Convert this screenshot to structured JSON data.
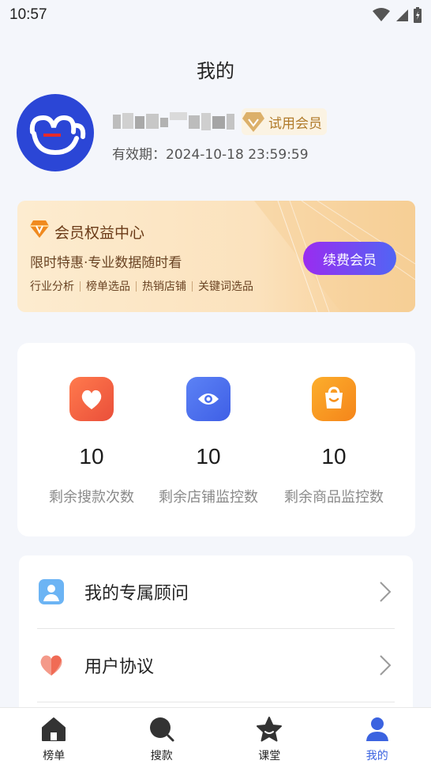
{
  "status_bar": {
    "time": "10:57"
  },
  "header": {
    "title": "我的"
  },
  "profile": {
    "member_badge": "试用会员",
    "validity": "有效期：2024-10-18 23:59:59"
  },
  "vip_card": {
    "title": "会员权益中心",
    "subtitle": "限时特惠·专业数据随时看",
    "tags": [
      "行业分析",
      "榜单选品",
      "热销店铺",
      "关键词选品"
    ],
    "renew_label": "续费会员"
  },
  "stats": [
    {
      "value": "10",
      "label": "剩余搜款次数",
      "icon": "heart-icon",
      "color": "#f0613f"
    },
    {
      "value": "10",
      "label": "剩余店铺监控数",
      "icon": "eye-icon",
      "color": "#4a6ff0"
    },
    {
      "value": "10",
      "label": "剩余商品监控数",
      "icon": "bag-icon",
      "color": "#f7921d"
    }
  ],
  "menu": [
    {
      "label": "我的专属顾问",
      "icon": "advisor-icon"
    },
    {
      "label": "用户协议",
      "icon": "agreement-heart-icon"
    }
  ],
  "tab_bar": {
    "items": [
      {
        "label": "榜单",
        "icon": "home-icon"
      },
      {
        "label": "搜款",
        "icon": "search-icon"
      },
      {
        "label": "课堂",
        "icon": "star-icon"
      },
      {
        "label": "我的",
        "icon": "user-icon"
      }
    ],
    "active_index": 3,
    "active_color": "#3b63e0"
  }
}
